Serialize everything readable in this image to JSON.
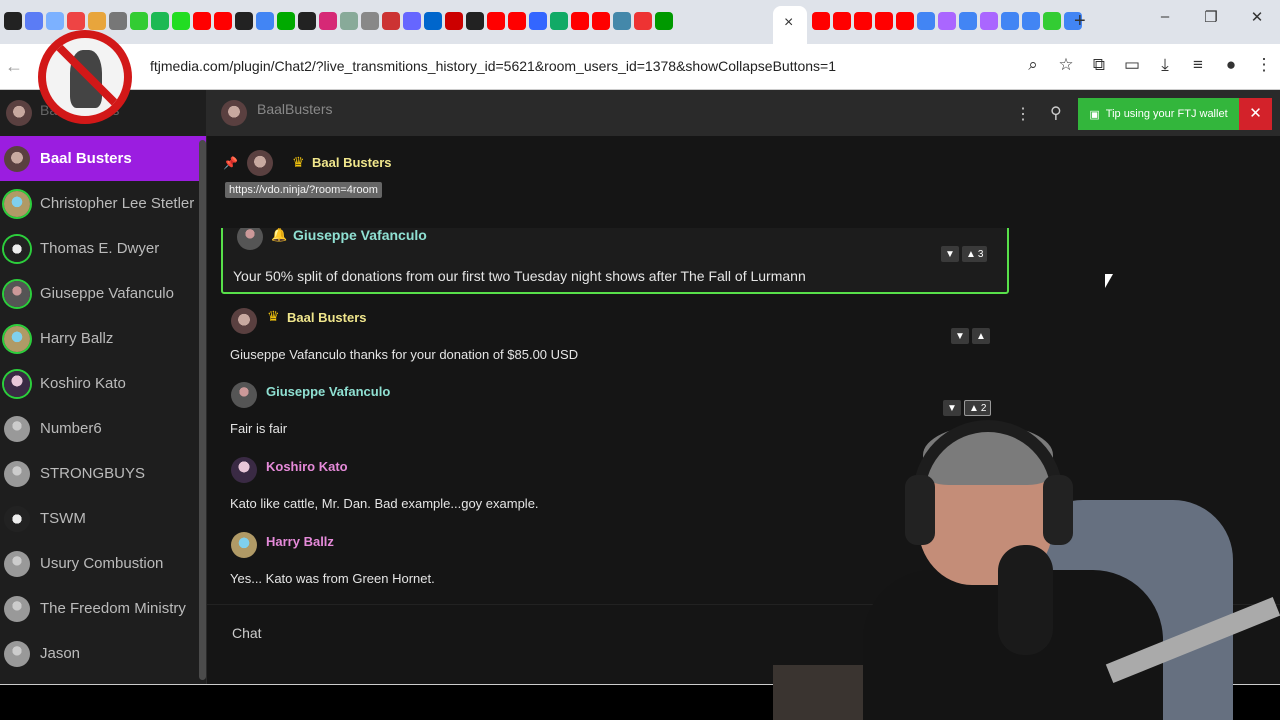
{
  "browser": {
    "url": "ftjmedia.com/plugin/Chat2/?live_transmitions_history_id=5621&room_users_id=1378&showCollapseButtons=1",
    "tab_close": "×",
    "new_tab": "+",
    "minimize": "–",
    "restore": "❐",
    "close": "✕"
  },
  "sidebar": {
    "top_label": "Baal Busters",
    "items": [
      {
        "name": "Baal Busters",
        "active": true
      },
      {
        "name": "Christopher Lee Stetler"
      },
      {
        "name": "Thomas E. Dwyer"
      },
      {
        "name": "Giuseppe Vafanculo"
      },
      {
        "name": "Harry Ballz"
      },
      {
        "name": "Koshiro Kato"
      },
      {
        "name": "Number6"
      },
      {
        "name": "STRONGBUYS"
      },
      {
        "name": "TSWM"
      },
      {
        "name": "Usury Combustion"
      },
      {
        "name": "The Freedom Ministry"
      },
      {
        "name": "Jason"
      }
    ]
  },
  "header": {
    "room": "BaalBusters",
    "tip_label": "Tip using your FTJ wallet",
    "close_label": "✕"
  },
  "pinned": {
    "user": "Baal Busters",
    "link": "https://vdo.ninja/?room=4room"
  },
  "messages": [
    {
      "user": "Giuseppe Vafanculo",
      "text": "Your 50% split of donations from our first two Tuesday night shows after The Fall of Lurmann",
      "likes": "3"
    },
    {
      "user": "Baal Busters",
      "text": "Giuseppe Vafanculo thanks for your donation of $85.00 USD",
      "likes": ""
    },
    {
      "user": "Giuseppe Vafanculo",
      "text": "Fair is fair",
      "likes": "2"
    },
    {
      "user": "Koshiro Kato",
      "text": "Kato like cattle, Mr. Dan. Bad example...goy example.",
      "likes": ""
    },
    {
      "user": "Harry Ballz",
      "text": "Yes... Kato was from Green Hornet.",
      "likes": ""
    }
  ],
  "input": {
    "placeholder": "Chat"
  },
  "colors": {
    "active_user_bg": "#9b1de0",
    "online_ring": "#2ccf3c",
    "crown": "#f3c40d",
    "tip_button": "#33b63c",
    "close_button": "#d3222a",
    "highlight_border": "#58e04a"
  }
}
